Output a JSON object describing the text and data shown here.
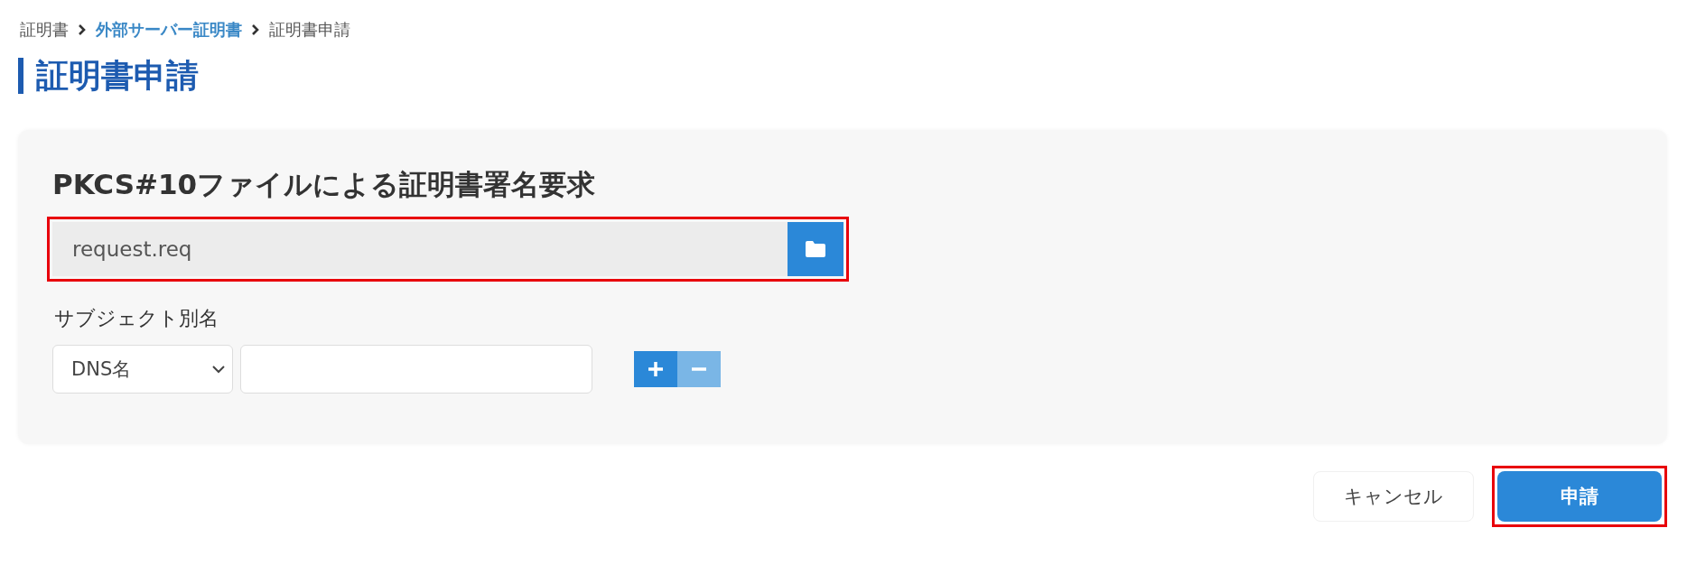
{
  "breadcrumb": [
    {
      "label": "証明書",
      "link": false
    },
    {
      "label": "外部サーバー証明書",
      "link": true
    },
    {
      "label": "証明書申請",
      "link": false
    }
  ],
  "title": "証明書申請",
  "card": {
    "heading": "PKCS#10ファイルによる証明書署名要求",
    "file_field": {
      "value": "request.req",
      "highlighted": true
    },
    "subject_alt_name": {
      "label": "サブジェクト別名",
      "type_select": {
        "value": "DNS名"
      },
      "add_disabled": false,
      "remove_disabled": true
    }
  },
  "buttons": [
    {
      "label": "キャンセル",
      "kind": "secondary",
      "highlighted": false
    },
    {
      "label": "申請",
      "kind": "primary",
      "highlighted": true
    }
  ]
}
